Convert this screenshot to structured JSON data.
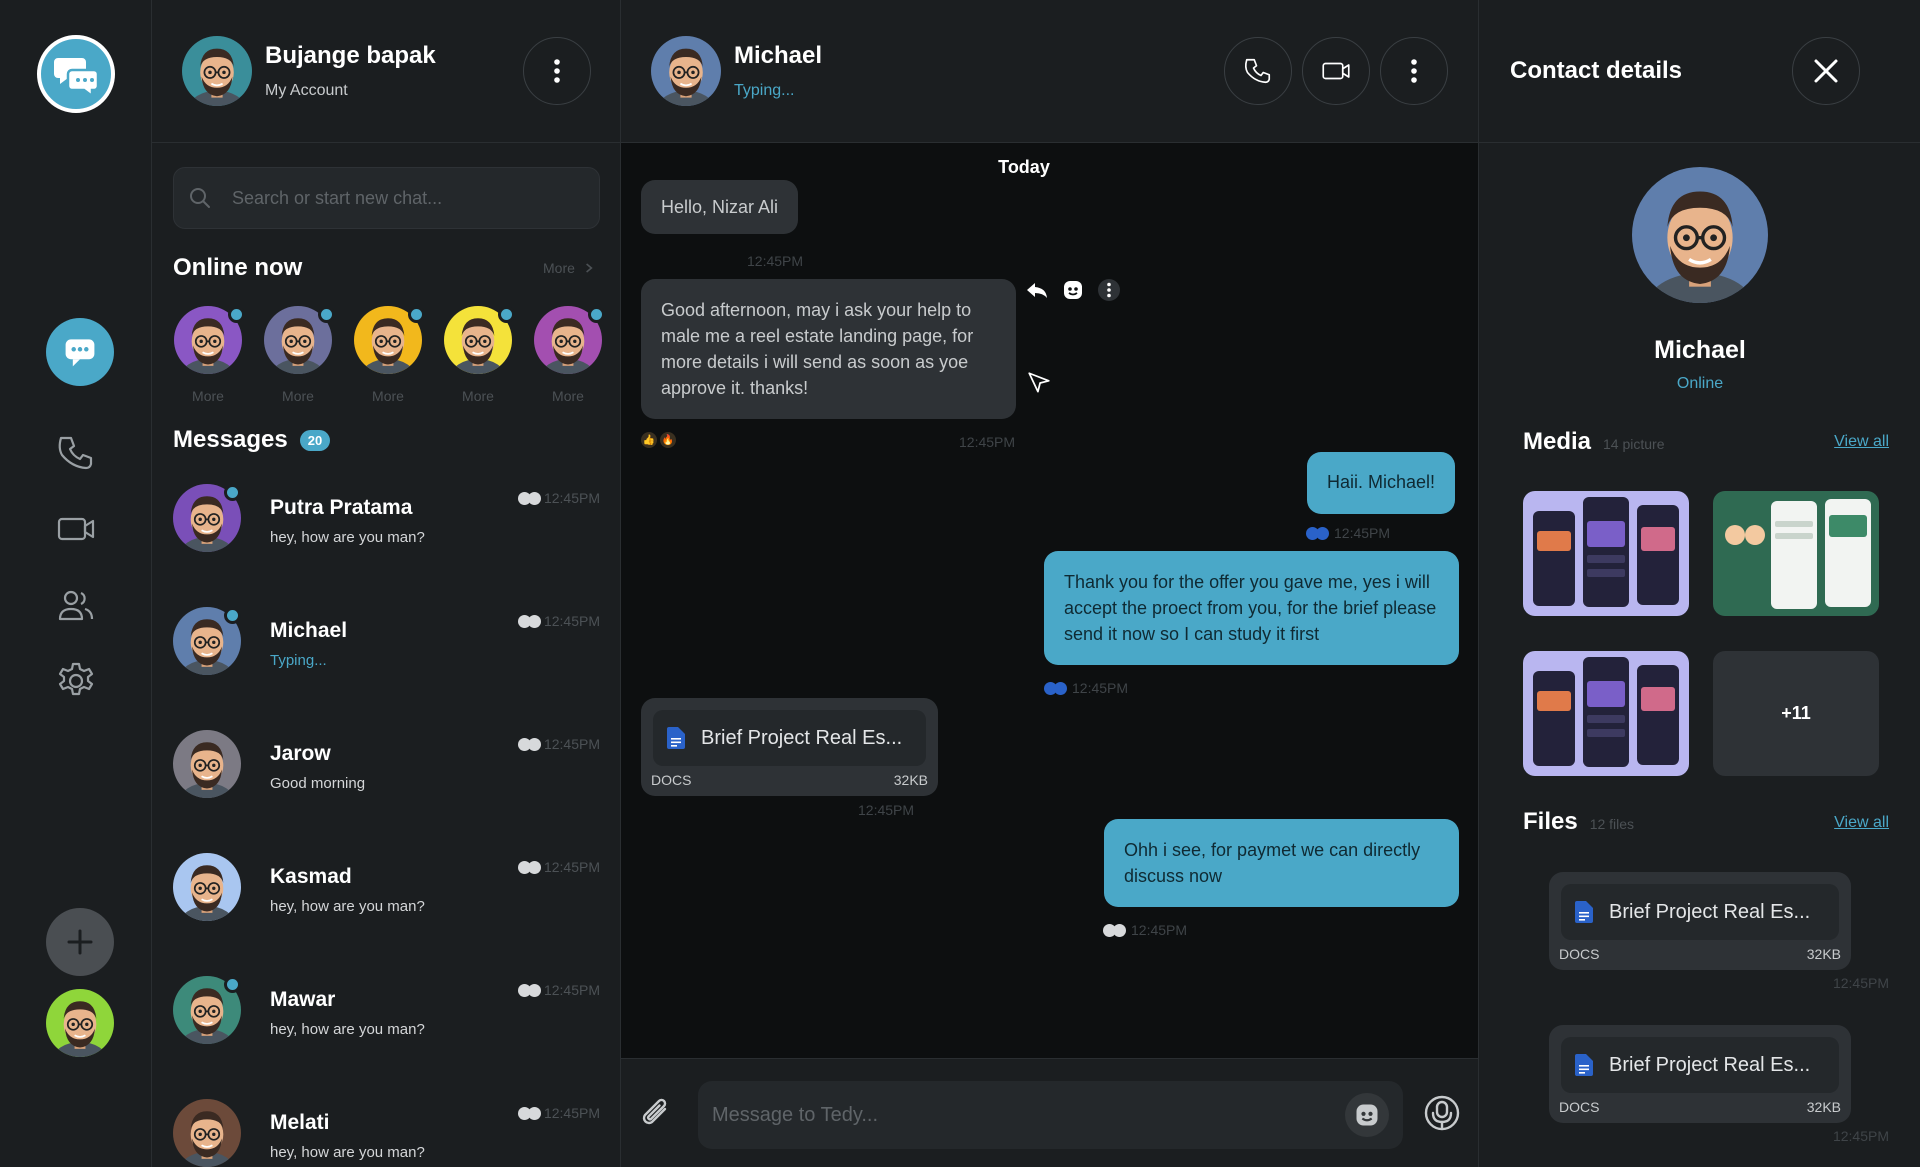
{
  "colors": {
    "accent": "#4aa8c8",
    "panel": "#1b1e20",
    "canvas": "#0d0f10",
    "bubble_in": "#2e3236",
    "read_tick": "#2a62c9"
  },
  "account": {
    "name": "Bujange bapak",
    "subtitle": "My Account"
  },
  "search": {
    "placeholder": "Search or start new chat..."
  },
  "online": {
    "title": "Online now",
    "more_label": "More",
    "people": [
      {
        "label": "More"
      },
      {
        "label": "More"
      },
      {
        "label": "More"
      },
      {
        "label": "More"
      },
      {
        "label": "More"
      }
    ]
  },
  "messages_section": {
    "title": "Messages",
    "count": "20"
  },
  "chats": [
    {
      "name": "Putra Pratama",
      "preview": "hey, how are you man?",
      "time": "12:45PM"
    },
    {
      "name": "Michael",
      "preview": "Typing...",
      "time": "12:45PM"
    },
    {
      "name": "Jarow",
      "preview": "Good morning",
      "time": "12:45PM"
    },
    {
      "name": "Kasmad",
      "preview": "hey, how are you man?",
      "time": "12:45PM"
    },
    {
      "name": "Mawar",
      "preview": "hey, how are you man?",
      "time": "12:45PM"
    },
    {
      "name": "Melati",
      "preview": "hey, how are you man?",
      "time": "12:45PM"
    }
  ],
  "conversation": {
    "name": "Michael",
    "status": "Typing...",
    "day_label": "Today",
    "messages": [
      {
        "text": "Hello, Nizar Ali",
        "time": "12:45PM"
      },
      {
        "text": "Good afternoon, may i ask your help to male me a reel estate landing page, for more details i will send as soon as yoe approve it. thanks!",
        "time": "12:45PM"
      },
      {
        "text": "Haii. Michael!",
        "time": "12:45PM"
      },
      {
        "text": "Thank you for the offer you gave me, yes i will accept the proect from you, for the brief please send it now so I can study it first",
        "time": "12:45PM"
      },
      {
        "text": "Ohh i see, for paymet we can directly discuss now",
        "time": "12:45PM"
      }
    ],
    "file": {
      "name": "Brief Project Real Es...",
      "type": "DOCS",
      "size": "32KB",
      "time": "12:45PM"
    },
    "composer_placeholder": "Message to Tedy..."
  },
  "details": {
    "title": "Contact details",
    "name": "Michael",
    "status": "Online",
    "media_title": "Media",
    "media_count": "14 picture",
    "view_all": "View all",
    "more_media": "+11",
    "files_title": "Files",
    "files_count": "12 files",
    "files": [
      {
        "name": "Brief Project Real Es...",
        "type": "DOCS",
        "size": "32KB",
        "time": "12:45PM"
      },
      {
        "name": "Brief Project Real Es...",
        "type": "DOCS",
        "size": "32KB",
        "time": "12:45PM"
      }
    ]
  },
  "icons": [
    "chat-bubbles-icon",
    "phone-icon",
    "video-icon",
    "users-icon",
    "gear-icon",
    "plus-icon",
    "more-vertical-icon",
    "search-icon",
    "chevron-right-icon",
    "close-icon",
    "reply-icon",
    "emoji-icon",
    "paperclip-icon",
    "microphone-icon",
    "document-icon"
  ]
}
